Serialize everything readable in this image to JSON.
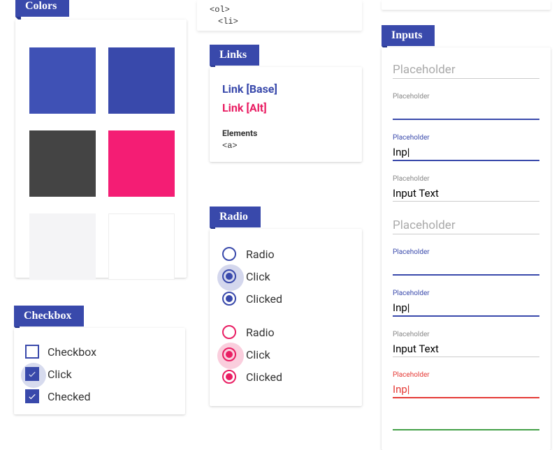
{
  "colors": {
    "title": "Colors",
    "swatches": [
      "#3f51b5",
      "#3949ab",
      "#444444",
      "#f41d74",
      "#f4f4f6",
      "#ffffff"
    ]
  },
  "checkbox": {
    "title": "Checkbox",
    "items": [
      {
        "label": "Checkbox",
        "checked": false,
        "halo": false
      },
      {
        "label": "Click",
        "checked": true,
        "halo": true
      },
      {
        "label": "Checked",
        "checked": true,
        "halo": false
      }
    ]
  },
  "snippet": {
    "lines": [
      "<ol>",
      "  <li>"
    ]
  },
  "links": {
    "title": "Links",
    "base": "Link [Base]",
    "alt": "Link [Alt]",
    "elements_label": "Elements",
    "elements_code": "<a>"
  },
  "radio": {
    "title": "Radio",
    "group1": [
      {
        "label": "Radio",
        "checked": false,
        "halo": false
      },
      {
        "label": "Click",
        "checked": true,
        "halo": true
      },
      {
        "label": "Clicked",
        "checked": true,
        "halo": false
      }
    ],
    "group2": [
      {
        "label": "Radio",
        "checked": false,
        "halo": false
      },
      {
        "label": "Click",
        "checked": true,
        "halo": true
      },
      {
        "label": "Clicked",
        "checked": true,
        "halo": false
      }
    ]
  },
  "inputs": {
    "title": "Inputs",
    "fields": [
      {
        "label": "",
        "value": "Placeholder",
        "placeholder_style": true,
        "underline": "gray"
      },
      {
        "label": "Placeholder",
        "value": "",
        "label_color": "gray",
        "underline": "blue"
      },
      {
        "label": "Placeholder",
        "value": "Inp",
        "cursor": true,
        "label_color": "blue",
        "underline": "blue"
      },
      {
        "label": "Placeholder",
        "value": "Input Text",
        "label_color": "gray",
        "underline": "gray"
      },
      {
        "label": "",
        "value": "Placeholder",
        "placeholder_style": true,
        "underline": "gray"
      },
      {
        "label": "Placeholder",
        "value": "",
        "label_color": "blue",
        "underline": "blue"
      },
      {
        "label": "Placeholder",
        "value": "Inp",
        "cursor": true,
        "label_color": "blue",
        "underline": "blue"
      },
      {
        "label": "Placeholder",
        "value": "Input Text",
        "label_color": "gray",
        "underline": "gray"
      },
      {
        "label": "Placeholder",
        "value": "Inp",
        "cursor": true,
        "label_color": "red",
        "underline": "red"
      },
      {
        "label": "",
        "value": "",
        "underline": "green"
      }
    ]
  }
}
